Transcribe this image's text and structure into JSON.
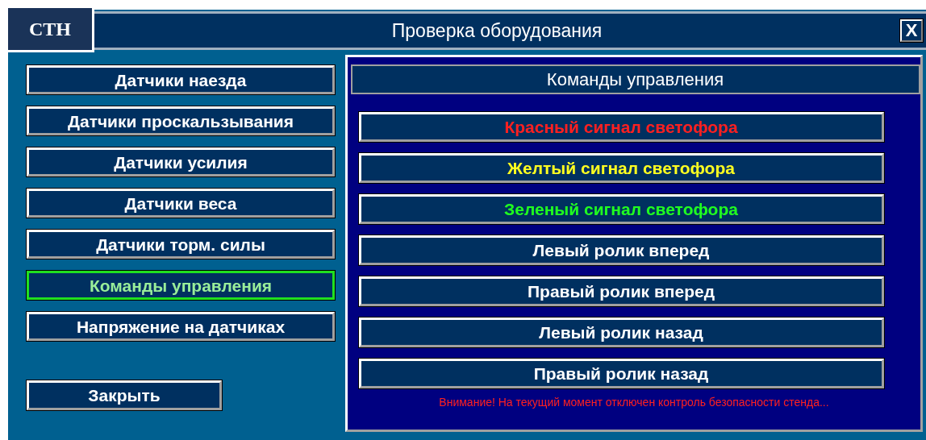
{
  "badge": "СТН",
  "window": {
    "title": "Проверка оборудования",
    "close": "X"
  },
  "sidebar": {
    "items": [
      {
        "label": "Датчики наезда",
        "selected": false
      },
      {
        "label": "Датчики проскальзывания",
        "selected": false
      },
      {
        "label": "Датчики усилия",
        "selected": false
      },
      {
        "label": "Датчики веса",
        "selected": false
      },
      {
        "label": "Датчики торм. силы",
        "selected": false
      },
      {
        "label": "Команды управления",
        "selected": true
      },
      {
        "label": "Напряжение на датчиках",
        "selected": false
      }
    ],
    "close_button": "Закрыть"
  },
  "panel": {
    "title": "Команды управления",
    "commands": [
      {
        "label": "Красный сигнал светофора",
        "color": "#ff2020"
      },
      {
        "label": "Желтый сигнал светофора",
        "color": "#ffff20"
      },
      {
        "label": "Зеленый сигнал светофора",
        "color": "#20ff20"
      },
      {
        "label": "Левый ролик вперед",
        "color": "#ffffff"
      },
      {
        "label": "Правый ролик вперед",
        "color": "#ffffff"
      },
      {
        "label": "Левый ролик назад",
        "color": "#ffffff"
      },
      {
        "label": "Правый ролик назад",
        "color": "#ffffff"
      }
    ],
    "warning": "Внимание! На текущий момент отключен контроль безопасности стенда..."
  }
}
